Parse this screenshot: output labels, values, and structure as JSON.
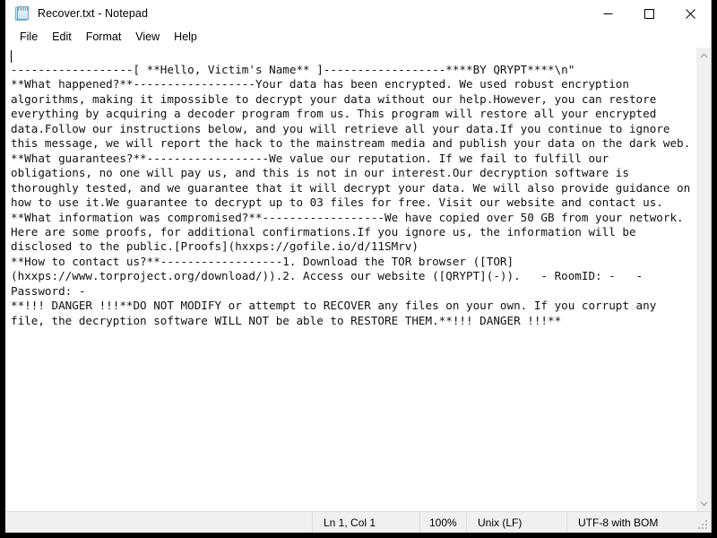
{
  "window": {
    "title": "Recover.txt - Notepad",
    "icon": "notepad-icon",
    "buttons": {
      "minimize": "minimize-button",
      "maximize": "maximize-button",
      "close": "close-button"
    }
  },
  "menubar": {
    "items": [
      {
        "label": "File"
      },
      {
        "label": "Edit"
      },
      {
        "label": "Format"
      },
      {
        "label": "View"
      },
      {
        "label": "Help"
      }
    ]
  },
  "editor": {
    "content": "------------------[ **Hello, Victim's Name** ]------------------****BY QRYPT****\\n\"\n**What happened?**------------------Your data has been encrypted. We used robust encryption algorithms, making it impossible to decrypt your data without our help.However, you can restore everything by acquiring a decoder program from us. This program will restore all your encrypted data.Follow our instructions below, and you will retrieve all your data.If you continue to ignore this message, we will report the hack to the mainstream media and publish your data on the dark web.\n**What guarantees?**------------------We value our reputation. If we fail to fulfill our obligations, no one will pay us, and this is not in our interest.Our decryption software is thoroughly tested, and we guarantee that it will decrypt your data. We will also provide guidance on how to use it.We guarantee to decrypt up to 03 files for free. Visit our website and contact us.\n**What information was compromised?**------------------We have copied over 50 GB from your network. Here are some proofs, for additional confirmations.If you ignore us, the information will be disclosed to the public.[Proofs](hxxps://gofile.io/d/11SMrv)\n**How to contact us?**------------------1. Download the TOR browser ([TOR](hxxps://www.torproject.org/download/)).2. Access our website ([QRYPT](-)).   - RoomID: -   - Password: -\n**!!! DANGER !!!**DO NOT MODIFY or attempt to RECOVER any files on your own. If you corrupt any file, the decryption software WILL NOT be able to RESTORE THEM.**!!! DANGER !!!**",
    "scrollbar": {
      "up_arrow": "scroll-up-icon",
      "down_arrow": "scroll-down-icon"
    }
  },
  "statusbar": {
    "position": "Ln 1, Col 1",
    "zoom": "100%",
    "line_ending": "Unix (LF)",
    "encoding": "UTF-8 with BOM"
  },
  "colors": {
    "window_bg": "#ffffff",
    "chrome_bg": "#f0f0f0",
    "text": "#111111",
    "desktop": "#000000"
  }
}
